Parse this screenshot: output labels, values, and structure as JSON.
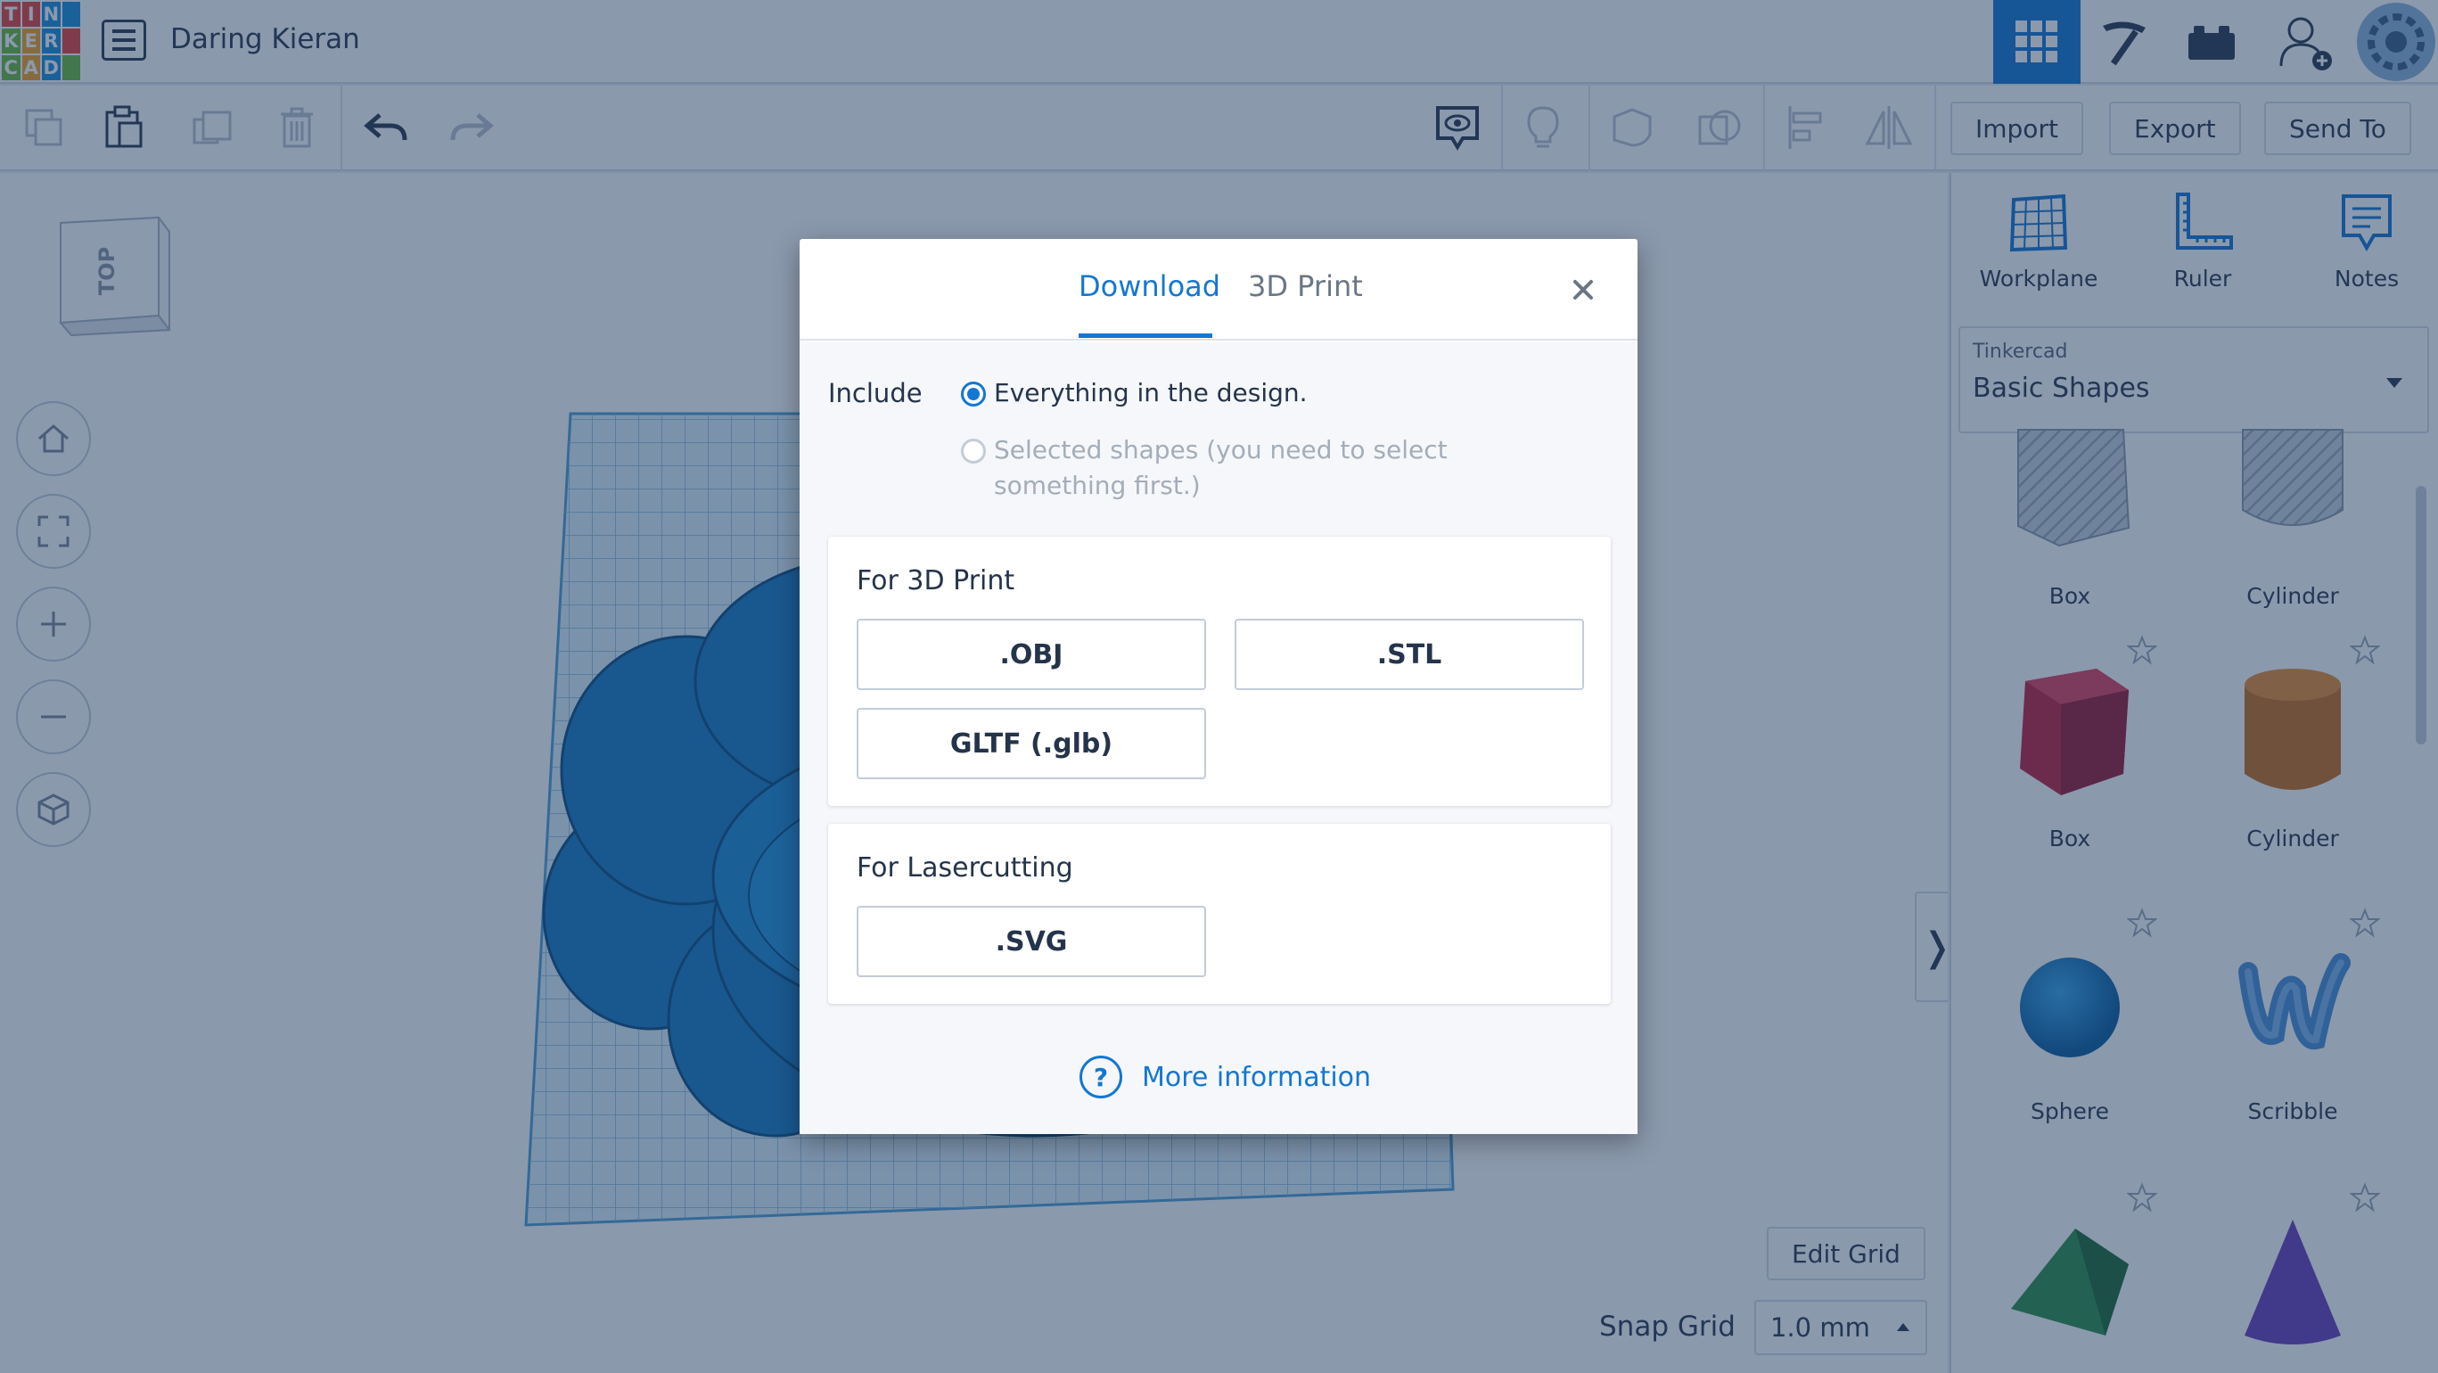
{
  "app": {
    "logo_letters": [
      "T",
      "I",
      "N",
      "K",
      "E",
      "R",
      "C",
      "A",
      "D"
    ],
    "design_title": "Daring Kieran"
  },
  "colors": {
    "accent": "#1477d1",
    "logo": [
      "#e8433a",
      "#e8433a",
      "#1b8fd8",
      "#1b8fd8",
      "#6cbb3c",
      "#f7a321",
      "#1b8fd8",
      "#e8433a",
      "#6cbb3c",
      "#f7a321",
      "#1b8fd8",
      "#6cbb3c"
    ]
  },
  "topbar": {
    "icons": [
      "grid-view-icon",
      "build-icon",
      "bricks-icon",
      "add-user-icon",
      "avatar"
    ]
  },
  "toolbar": {
    "import_label": "Import",
    "export_label": "Export",
    "send_to_label": "Send To"
  },
  "canvas": {
    "viewcube_label": "TOP",
    "edit_grid_label": "Edit Grid",
    "snap_grid_label": "Snap Grid",
    "snap_grid_value": "1.0 mm",
    "collapse_glyph": "❭"
  },
  "panel": {
    "tools": [
      {
        "label": "Workplane"
      },
      {
        "label": "Ruler"
      },
      {
        "label": "Notes"
      }
    ],
    "library": {
      "provider": "Tinkercad",
      "name": "Basic Shapes"
    },
    "shapes": [
      {
        "label": "Box"
      },
      {
        "label": "Cylinder"
      },
      {
        "label": "Box"
      },
      {
        "label": "Cylinder"
      },
      {
        "label": "Sphere"
      },
      {
        "label": "Scribble"
      }
    ]
  },
  "dialog": {
    "tabs": [
      {
        "label": "Download",
        "active": true
      },
      {
        "label": "3D Print",
        "active": false
      }
    ],
    "include_label": "Include",
    "option_everything": "Everything in the design.",
    "option_selected_line1": "Selected shapes (you need to select",
    "option_selected_line2": "something first.)",
    "print_section": {
      "title": "For 3D Print",
      "buttons": [
        ".OBJ",
        ".STL",
        "GLTF (.glb)"
      ]
    },
    "laser_section": {
      "title": "For Lasercutting",
      "buttons": [
        ".SVG"
      ]
    },
    "more_info_label": "More information",
    "help_glyph": "?"
  }
}
